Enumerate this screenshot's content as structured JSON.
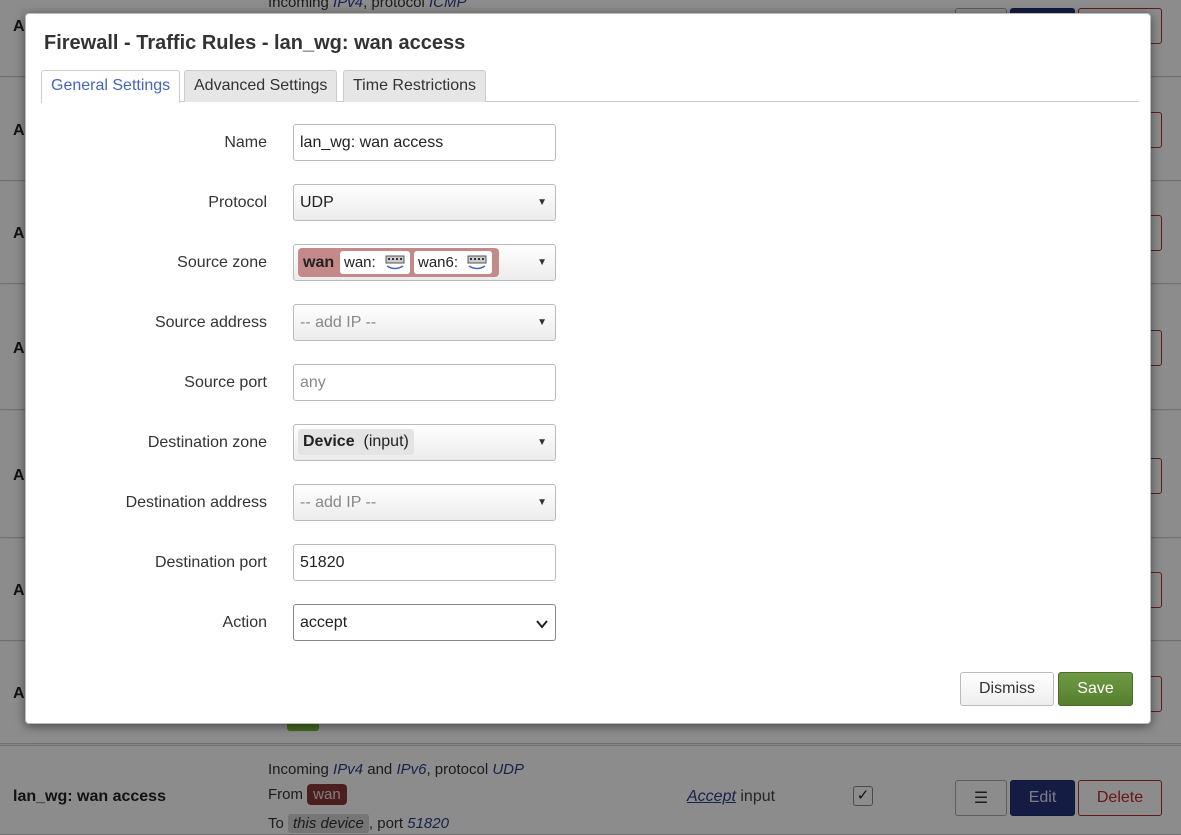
{
  "modal": {
    "title": "Firewall - Traffic Rules - lan_wg: wan access",
    "tabs": [
      "General Settings",
      "Advanced Settings",
      "Time Restrictions"
    ],
    "active_tab": "General Settings",
    "fields": {
      "name": {
        "label": "Name",
        "value": "lan_wg: wan access"
      },
      "protocol": {
        "label": "Protocol",
        "value": "UDP"
      },
      "source_zone": {
        "label": "Source zone",
        "zone": "wan",
        "interfaces": [
          "wan:",
          "wan6:"
        ]
      },
      "source_address": {
        "label": "Source address",
        "placeholder": "-- add IP --"
      },
      "source_port": {
        "label": "Source port",
        "placeholder": "any"
      },
      "destination_zone": {
        "label": "Destination zone",
        "value_bold": "Device",
        "value_rest": "(input)"
      },
      "destination_address": {
        "label": "Destination address",
        "placeholder": "-- add IP --"
      },
      "destination_port": {
        "label": "Destination port",
        "value": "51820"
      },
      "action": {
        "label": "Action",
        "value": "accept"
      }
    },
    "buttons": {
      "dismiss": "Dismiss",
      "save": "Save"
    }
  },
  "background": {
    "row_initial": "A",
    "top_partial": {
      "incoming": "Incoming",
      "ipv4": "IPv4",
      "protocol": "protocol",
      "proto_value": "ICMP"
    },
    "last_row": {
      "name": "lan_wg: wan access",
      "incoming": "Incoming",
      "ipv4": "IPv4",
      "and": "and",
      "ipv6": "IPv6",
      "protocol_label": ", protocol",
      "protocol": "UDP",
      "from_label": "From",
      "from_zone": "wan",
      "to_label": "To",
      "to_dest": "this device",
      "port_label": ", port",
      "port": "51820",
      "action_word": "Accept",
      "action_rest": "input",
      "reorder": "☰",
      "edit": "Edit",
      "delete": "Delete"
    }
  },
  "colors": {
    "zone_wan": "#c48a8a",
    "save": "#5f8a36",
    "edit": "#27347a",
    "delete": "#c02828",
    "tab_active": "#4466bb"
  }
}
